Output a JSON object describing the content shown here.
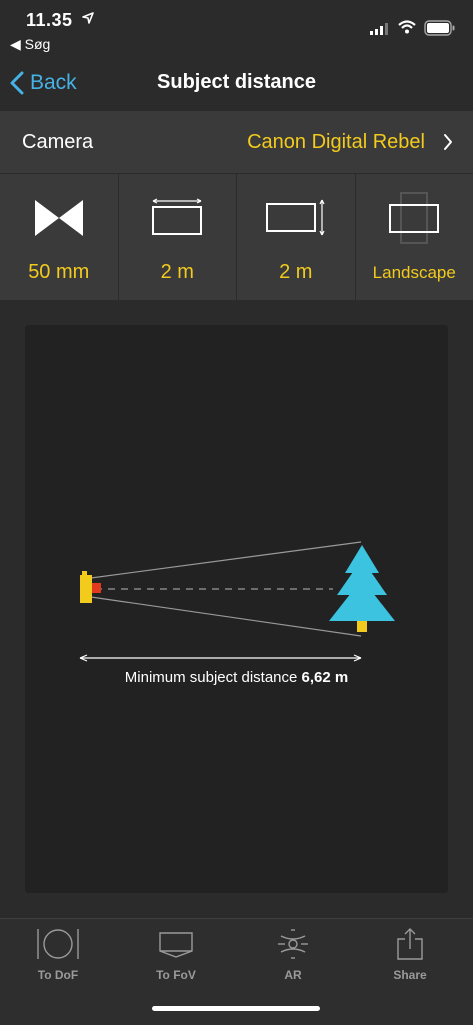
{
  "status": {
    "time": "11.35",
    "back_app": "◀ Søg"
  },
  "nav": {
    "back_label": "Back",
    "title": "Subject distance"
  },
  "camera": {
    "label": "Camera",
    "value": "Canon Digital Rebel"
  },
  "settings": [
    {
      "value": "50 mm"
    },
    {
      "value": "2 m"
    },
    {
      "value": "2 m"
    },
    {
      "value": "Landscape"
    }
  ],
  "diagram": {
    "caption": "Minimum subject distance ",
    "distance": "6,62 m"
  },
  "tabs": [
    {
      "label": "To DoF"
    },
    {
      "label": "To FoV"
    },
    {
      "label": "AR"
    },
    {
      "label": "Share"
    }
  ],
  "colors": {
    "accent": "#f2cb1d",
    "link": "#46b3e6",
    "tree": "#3bc3e0"
  }
}
